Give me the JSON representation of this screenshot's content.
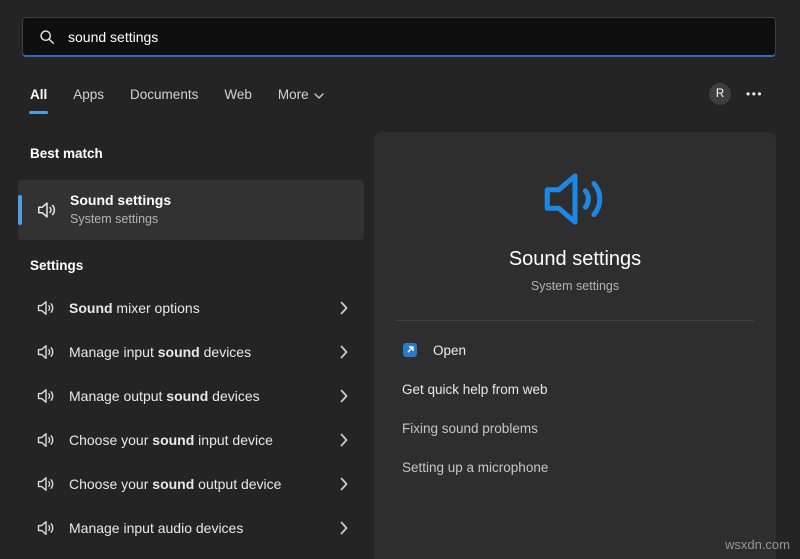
{
  "search": {
    "value": "sound settings"
  },
  "tabs": {
    "items": [
      {
        "label": "All",
        "active": true
      },
      {
        "label": "Apps",
        "active": false
      },
      {
        "label": "Documents",
        "active": false
      },
      {
        "label": "Web",
        "active": false
      },
      {
        "label": "More",
        "active": false,
        "has_dropdown": true
      }
    ],
    "profile_initial": "R",
    "more_options": "•••"
  },
  "best_match": {
    "heading": "Best match",
    "item": {
      "title": "Sound settings",
      "subtitle": "System settings"
    }
  },
  "results": {
    "heading": "Settings",
    "items": [
      {
        "pre": "",
        "bold": "Sound",
        "post": " mixer options"
      },
      {
        "pre": "Manage input ",
        "bold": "sound",
        "post": " devices"
      },
      {
        "pre": "Manage output ",
        "bold": "sound",
        "post": " devices"
      },
      {
        "pre": "Choose your ",
        "bold": "sound",
        "post": " input device"
      },
      {
        "pre": "Choose your ",
        "bold": "sound",
        "post": " output device"
      },
      {
        "pre": "Manage input audio devices",
        "bold": "",
        "post": ""
      }
    ]
  },
  "preview": {
    "title": "Sound settings",
    "subtitle": "System settings",
    "open_label": "Open",
    "links": [
      "Get quick help from web",
      "Fixing sound problems",
      "Setting up a microphone"
    ]
  },
  "watermark": "wsxdn.com",
  "colors": {
    "accent": "#4ca0e0",
    "search_underline": "#2e6db5",
    "speaker_blue": "#1e87e5",
    "open_icon_blue": "#2979cc",
    "panel_bg": "#2e2e2e",
    "background": "#242424"
  },
  "icons": {
    "search": "magnifier",
    "speaker": "speaker-with-sound-waves",
    "chevron_right": "›",
    "chevron_down": "⌄",
    "external_open": "open-in-new-arrow",
    "ellipsis": "•••"
  }
}
